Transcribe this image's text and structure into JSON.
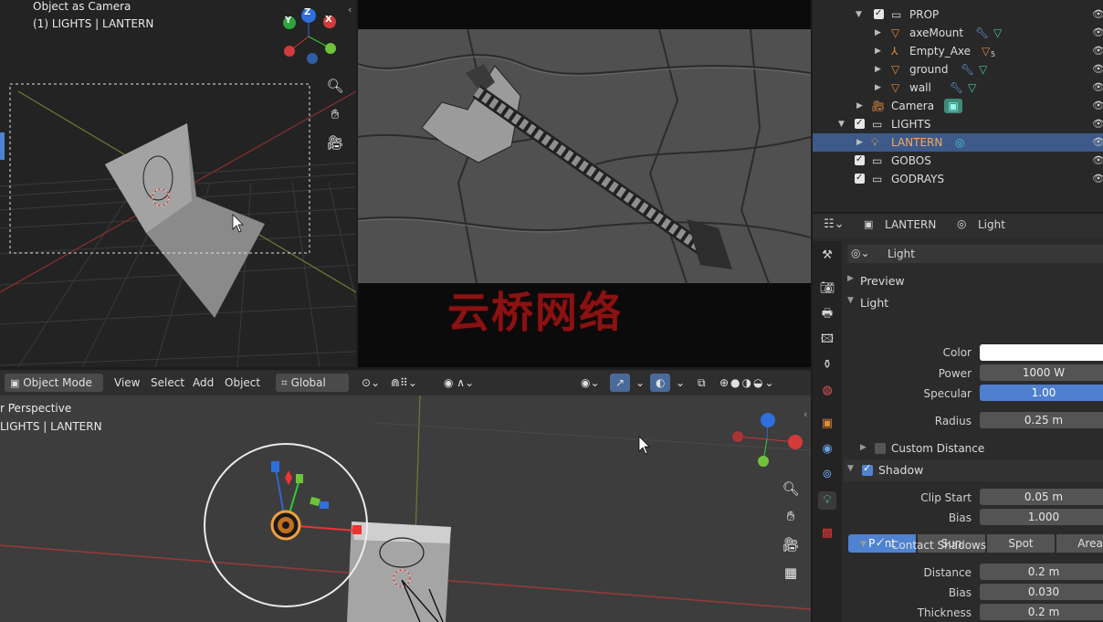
{
  "camera_view": {
    "title": "Object as Camera",
    "subtitle": "(1) LIGHTS | LANTERN",
    "gizmo": {
      "y": "Y",
      "z": "Z",
      "x": "X"
    }
  },
  "main_view": {
    "header": {
      "mode": "Object Mode",
      "menus": [
        "View",
        "Select",
        "Add",
        "Object"
      ],
      "transform_orientation": "Global"
    },
    "title": "r Perspective",
    "subtitle": "LIGHTS | LANTERN"
  },
  "outliner": {
    "rows": [
      {
        "label": "PROP",
        "type": "collection"
      },
      {
        "label": "axeMount",
        "type": "mesh"
      },
      {
        "label": "Empty_Axe",
        "type": "empty"
      },
      {
        "label": "ground",
        "type": "mesh"
      },
      {
        "label": "wall",
        "type": "mesh"
      },
      {
        "label": "Camera",
        "type": "camera"
      },
      {
        "label": "LIGHTS",
        "type": "collection"
      },
      {
        "label": "LANTERN",
        "type": "light",
        "selected": true
      },
      {
        "label": "GOBOS",
        "type": "collection"
      },
      {
        "label": "GODRAYS",
        "type": "collection"
      }
    ],
    "empty_badge": "5"
  },
  "properties": {
    "breadcrumb": {
      "object": "LANTERN",
      "data": "Light"
    },
    "datablock": "Light",
    "sections": {
      "preview": "Preview",
      "light": "Light",
      "shadow": "Shadow",
      "custom_distance": "Custom Distance",
      "contact_shadows": "Contact Shadows"
    },
    "light_types": [
      "Point",
      "Sun",
      "Spot",
      "Area"
    ],
    "active_light_type": "Point",
    "fields": {
      "color_label": "Color",
      "power_label": "Power",
      "power": "1000 W",
      "specular_label": "Specular",
      "specular": "1.00",
      "radius_label": "Radius",
      "radius": "0.25 m",
      "clip_start_label": "Clip Start",
      "clip_start": "0.05 m",
      "bias_label": "Bias",
      "bias": "1.000",
      "distance_label": "Distance",
      "distance": "0.2 m",
      "cs_bias_label": "Bias",
      "cs_bias": "0.030",
      "thickness_label": "Thickness",
      "thickness": "0.2 m"
    }
  },
  "watermark": "云桥网络",
  "colors": {
    "selection": "#3d5a8a",
    "accent_blue": "#4f83d1",
    "mesh_orange": "#e08a3c",
    "data_green": "#4fc3a0"
  }
}
